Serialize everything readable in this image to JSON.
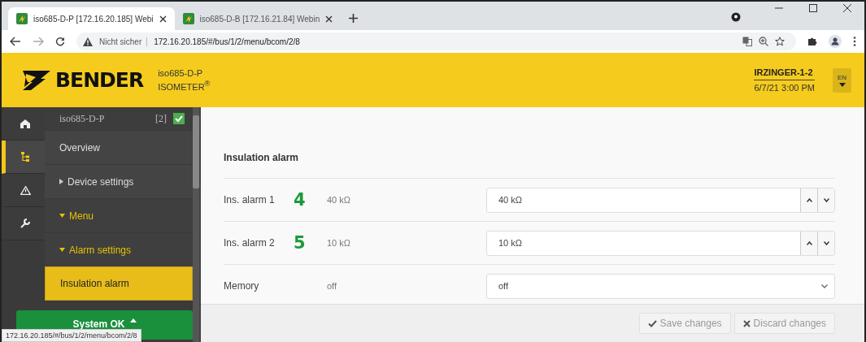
{
  "browser": {
    "tabs": [
      {
        "title": "iso685-D-P [172.16.20.185] Webi",
        "selected": true
      },
      {
        "title": "iso685-D-B [172.16.21.84] Webin",
        "selected": false
      }
    ],
    "security": "Nicht sicher",
    "url": "172.16.20.185/#/bus/1/2/menu/bcom/2/8"
  },
  "header": {
    "brand": "BENDER",
    "device_name": "iso685-D-P",
    "device_type": "ISOMETER$^{®}$",
    "location": "IRZINGER-1-2",
    "datetime": "6/7/21 3:00 PM",
    "language": "EN"
  },
  "rail": [
    {
      "kind": "home",
      "selected": false
    },
    {
      "kind": "tree",
      "selected": true
    },
    {
      "kind": "warning",
      "selected": false
    },
    {
      "kind": "wrench",
      "selected": false
    }
  ],
  "nav": {
    "device": {
      "name": "iso685-D-P",
      "address": "[2]",
      "ok": true
    },
    "items": [
      {
        "label": "Overview",
        "kind": "link",
        "selected": false
      },
      {
        "label": "Device settings",
        "kind": "group",
        "expanded": false,
        "selected": false
      },
      {
        "label": "Menu",
        "kind": "group",
        "expanded": true,
        "selected": false
      },
      {
        "label": "Alarm settings",
        "kind": "group",
        "expanded": true,
        "selected": false
      },
      {
        "label": "Insulation alarm",
        "kind": "link",
        "selected": true
      }
    ],
    "status_button": "System OK"
  },
  "content": {
    "title": "Insulation alarm",
    "rows": [
      {
        "label": "Ins. alarm 1",
        "callout": "4",
        "current": "40 kΩ",
        "value": "40 kΩ",
        "kind": "spinner"
      },
      {
        "label": "Ins. alarm 2",
        "callout": "5",
        "current": "10 kΩ",
        "value": "10 kΩ",
        "kind": "spinner"
      },
      {
        "label": "Memory",
        "current": "off",
        "value": "off",
        "kind": "select"
      }
    ],
    "buttons": [
      {
        "label": "Save changes",
        "kind": "save",
        "disabled": true
      },
      {
        "label": "Discard changes",
        "kind": "discard",
        "disabled": true
      }
    ]
  },
  "status_url": "172.16.20.185/#/bus/1/2/menu/bcom/2/8"
}
